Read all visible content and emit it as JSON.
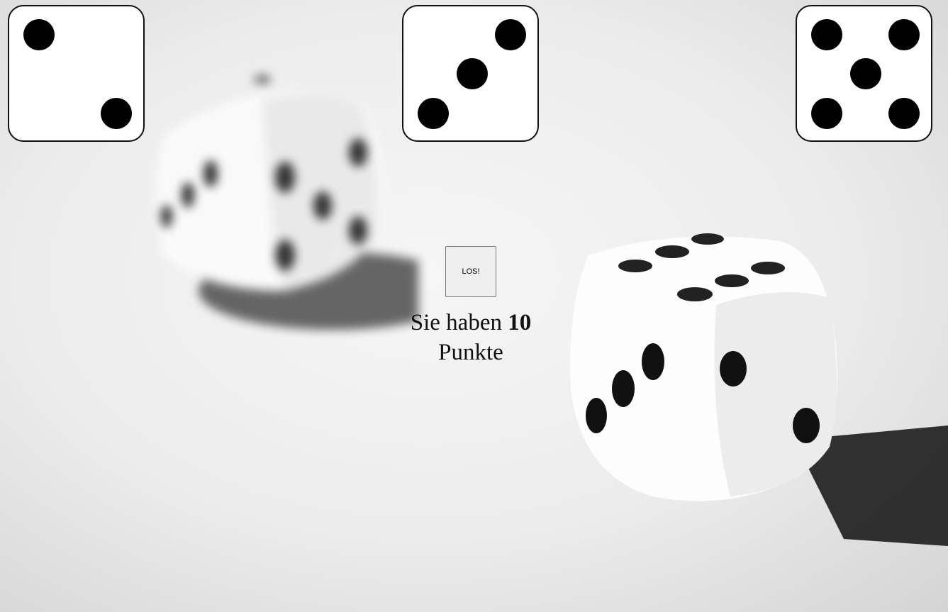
{
  "dice": [
    {
      "value": 2,
      "pips": [
        "tl",
        "br"
      ]
    },
    {
      "value": 3,
      "pips": [
        "tr",
        "mm",
        "bl"
      ]
    },
    {
      "value": 5,
      "pips": [
        "tl",
        "tr",
        "mm",
        "bl",
        "br"
      ]
    }
  ],
  "button": {
    "label": "LOS!"
  },
  "score": {
    "prefix": "Sie haben",
    "points": "10",
    "suffix": "Punkte"
  },
  "background": {
    "image": "dice-photo",
    "colors": {
      "table": "#ececec",
      "die": "#ffffff",
      "pip": "#000000"
    }
  }
}
